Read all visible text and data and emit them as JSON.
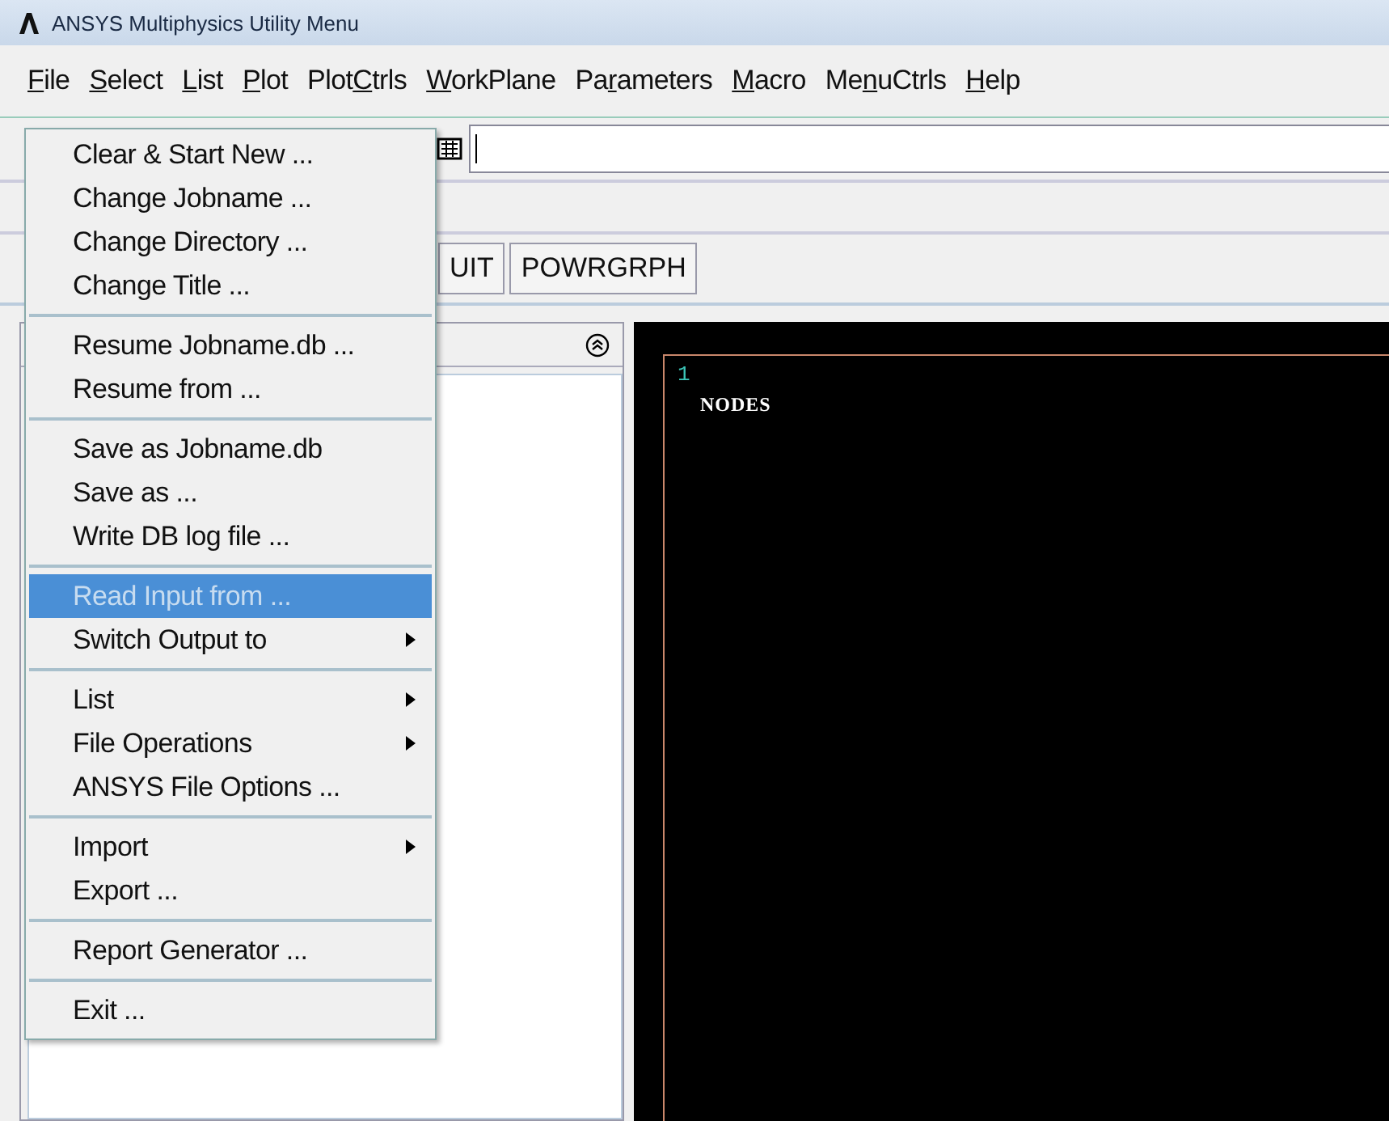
{
  "window": {
    "title": "ANSYS Multiphysics Utility Menu"
  },
  "menu_bar": [
    {
      "mnemonic": "F",
      "after": "ile"
    },
    {
      "mnemonic": "S",
      "after": "elect"
    },
    {
      "mnemonic": "L",
      "after": "ist"
    },
    {
      "mnemonic": "P",
      "after": "lot"
    },
    {
      "before": "Plot",
      "mnemonic": "C",
      "after": "trls"
    },
    {
      "mnemonic": "W",
      "after": "orkPlane"
    },
    {
      "before": "Pa",
      "mnemonic": "r",
      "after": "ameters"
    },
    {
      "mnemonic": "M",
      "after": "acro"
    },
    {
      "before": "Me",
      "mnemonic": "n",
      "after": "uCtrls"
    },
    {
      "mnemonic": "H",
      "after": "elp"
    }
  ],
  "toolbar_buttons": [
    "UIT",
    "POWRGRPH"
  ],
  "graphics": {
    "window_number": "1",
    "label": "NODES"
  },
  "file_menu": {
    "groups": [
      [
        {
          "label": "Clear & Start New ...",
          "submenu": false,
          "selected": false
        },
        {
          "label": "Change Jobname ...",
          "submenu": false,
          "selected": false
        },
        {
          "label": "Change Directory ...",
          "submenu": false,
          "selected": false
        },
        {
          "label": "Change Title ...",
          "submenu": false,
          "selected": false
        }
      ],
      [
        {
          "label": "Resume Jobname.db ...",
          "submenu": false,
          "selected": false
        },
        {
          "label": "Resume from ...",
          "submenu": false,
          "selected": false
        }
      ],
      [
        {
          "label": "Save as Jobname.db",
          "submenu": false,
          "selected": false
        },
        {
          "label": "Save as ...",
          "submenu": false,
          "selected": false
        },
        {
          "label": "Write DB log file ...",
          "submenu": false,
          "selected": false
        }
      ],
      [
        {
          "label": "Read Input from ...",
          "submenu": false,
          "selected": true
        },
        {
          "label": "Switch Output to",
          "submenu": true,
          "selected": false
        }
      ],
      [
        {
          "label": "List",
          "submenu": true,
          "selected": false
        },
        {
          "label": "File Operations",
          "submenu": true,
          "selected": false
        },
        {
          "label": "ANSYS File Options ...",
          "submenu": false,
          "selected": false
        }
      ],
      [
        {
          "label": "Import",
          "submenu": true,
          "selected": false
        },
        {
          "label": "Export ...",
          "submenu": false,
          "selected": false
        }
      ],
      [
        {
          "label": "Report Generator ...",
          "submenu": false,
          "selected": false
        }
      ],
      [
        {
          "label": "Exit ...",
          "submenu": false,
          "selected": false
        }
      ]
    ]
  }
}
